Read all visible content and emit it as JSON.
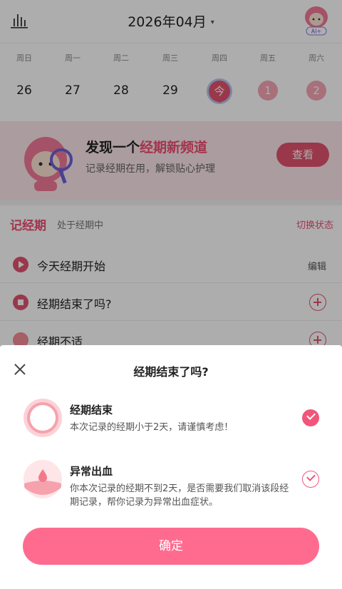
{
  "header": {
    "month_title": "2026年04月",
    "caret": "▾",
    "stats_icon": "bar-chart-icon",
    "avatar_label": "AI+"
  },
  "week": {
    "weekdays": [
      "周日",
      "周一",
      "周二",
      "周三",
      "周四",
      "周五",
      "周六"
    ],
    "dates": [
      "26",
      "27",
      "28",
      "29",
      "今",
      "1",
      "2"
    ],
    "today_index": 4
  },
  "promo": {
    "title_prefix": "发现一个",
    "title_highlight": "经期新频道",
    "subtitle": "记录经期在用，解锁贴心护理",
    "button": "查看"
  },
  "period": {
    "title": "记经期",
    "status": "处于经期中",
    "switch": "切换状态"
  },
  "list": [
    {
      "label": "今天经期开始",
      "action": "编辑"
    },
    {
      "label": "经期结束了吗?",
      "action": ""
    },
    {
      "label": "经期不适",
      "action": ""
    }
  ],
  "sheet": {
    "title": "经期结束了吗?",
    "options": [
      {
        "name": "经期结束",
        "desc": "本次记录的经期小于2天，请谨慎考虑！",
        "selected": true
      },
      {
        "name": "异常出血",
        "desc": "你本次记录的经期不到2天，是否需要我们取消该段经期记录，帮你记录为异常出血症状。",
        "selected": false
      }
    ],
    "confirm": "确定"
  },
  "colors": {
    "accent": "#e2536f",
    "confirm_button": "#ff6b8e",
    "promo_bg": "#fde6ea"
  }
}
